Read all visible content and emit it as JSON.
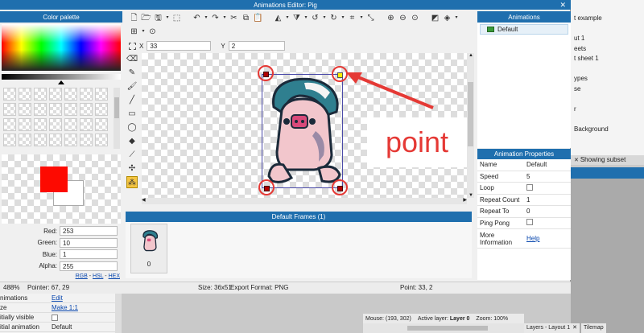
{
  "window": {
    "title": "Animations Editor: Pig"
  },
  "palette": {
    "title": "Color palette",
    "red_label": "Red:",
    "red": "253",
    "green_label": "Green:",
    "green": "10",
    "blue_label": "Blue:",
    "blue": "1",
    "alpha_label": "Alpha:",
    "alpha": "255",
    "links": [
      "RGB",
      "HSL",
      "HEX"
    ],
    "primary_color": "#fd0a01"
  },
  "coords": {
    "x_label": "X",
    "x": "33",
    "y_label": "Y",
    "y": "2"
  },
  "frames": {
    "title": "Default Frames (1)",
    "frame_index": "0"
  },
  "annotation": {
    "text": "point"
  },
  "animations": {
    "title": "Animations",
    "items": [
      "Default"
    ]
  },
  "properties": {
    "title": "Animation Properties",
    "rows": [
      {
        "key": "Name",
        "value": "Default",
        "type": "text"
      },
      {
        "key": "Speed",
        "value": "5",
        "type": "text"
      },
      {
        "key": "Loop",
        "value": "",
        "type": "checkbox"
      },
      {
        "key": "Repeat Count",
        "value": "1",
        "type": "text"
      },
      {
        "key": "Repeat To",
        "value": "0",
        "type": "text"
      },
      {
        "key": "Ping Pong",
        "value": "",
        "type": "checkbox"
      }
    ],
    "more_info_label": "More Information",
    "help_link": "Help"
  },
  "status": {
    "zoom": "488%",
    "pointer": "Pointer: 67, 29",
    "size": "Size: 36x51",
    "format": "Export Format: PNG",
    "point": "Point: 33, 2"
  },
  "background": {
    "right_items": [
      "t example",
      "",
      "ut 1",
      "eets",
      "t sheet 1",
      "",
      "ypes",
      "se",
      "",
      "r",
      "",
      "Background"
    ],
    "showing_subset": "Showing subset",
    "left_rows": [
      {
        "label": "nimations",
        "value": "Edit",
        "link": true
      },
      {
        "label": "ze",
        "value": "Make 1:1",
        "link": true
      },
      {
        "label": "itially visible",
        "value": "",
        "checkbox": true
      },
      {
        "label": "itial animation",
        "value": "Default",
        "link": false
      }
    ],
    "mouse": "Mouse: (193, 302)",
    "active_layer_label": "Active layer:",
    "active_layer": "Layer 0",
    "zoom": "Zoom: 100%",
    "tabs": [
      "Layers - Layout 1",
      "Tilemap"
    ]
  }
}
